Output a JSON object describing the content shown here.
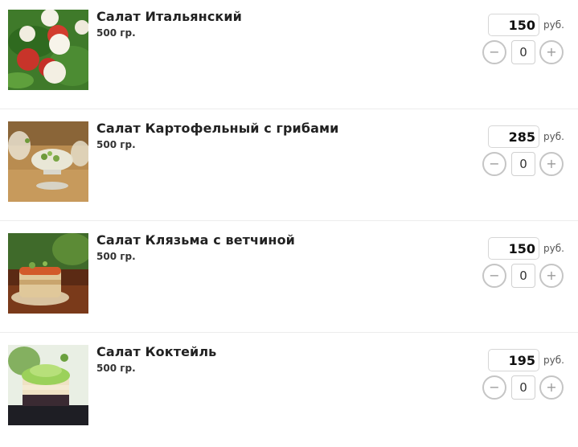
{
  "items": [
    {
      "title": "Салат Итальянский",
      "weight": "500 гр.",
      "price": "150",
      "currency": "руб.",
      "quantity": "0",
      "minus_label": "−",
      "plus_label": "+",
      "image_icon": "salad-caprese-image"
    },
    {
      "title": "Салат Картофельный с грибами",
      "weight": "500 гр.",
      "price": "285",
      "currency": "руб.",
      "quantity": "0",
      "minus_label": "−",
      "plus_label": "+",
      "image_icon": "salad-potato-image"
    },
    {
      "title": "Салат Клязьма с ветчиной",
      "weight": "500 гр.",
      "price": "150",
      "currency": "руб.",
      "quantity": "0",
      "minus_label": "−",
      "plus_label": "+",
      "image_icon": "salad-ham-image"
    },
    {
      "title": "Салат Коктейль",
      "weight": "500 гр.",
      "price": "195",
      "currency": "руб.",
      "quantity": "0",
      "minus_label": "−",
      "plus_label": "+",
      "image_icon": "salad-cocktail-image"
    }
  ]
}
